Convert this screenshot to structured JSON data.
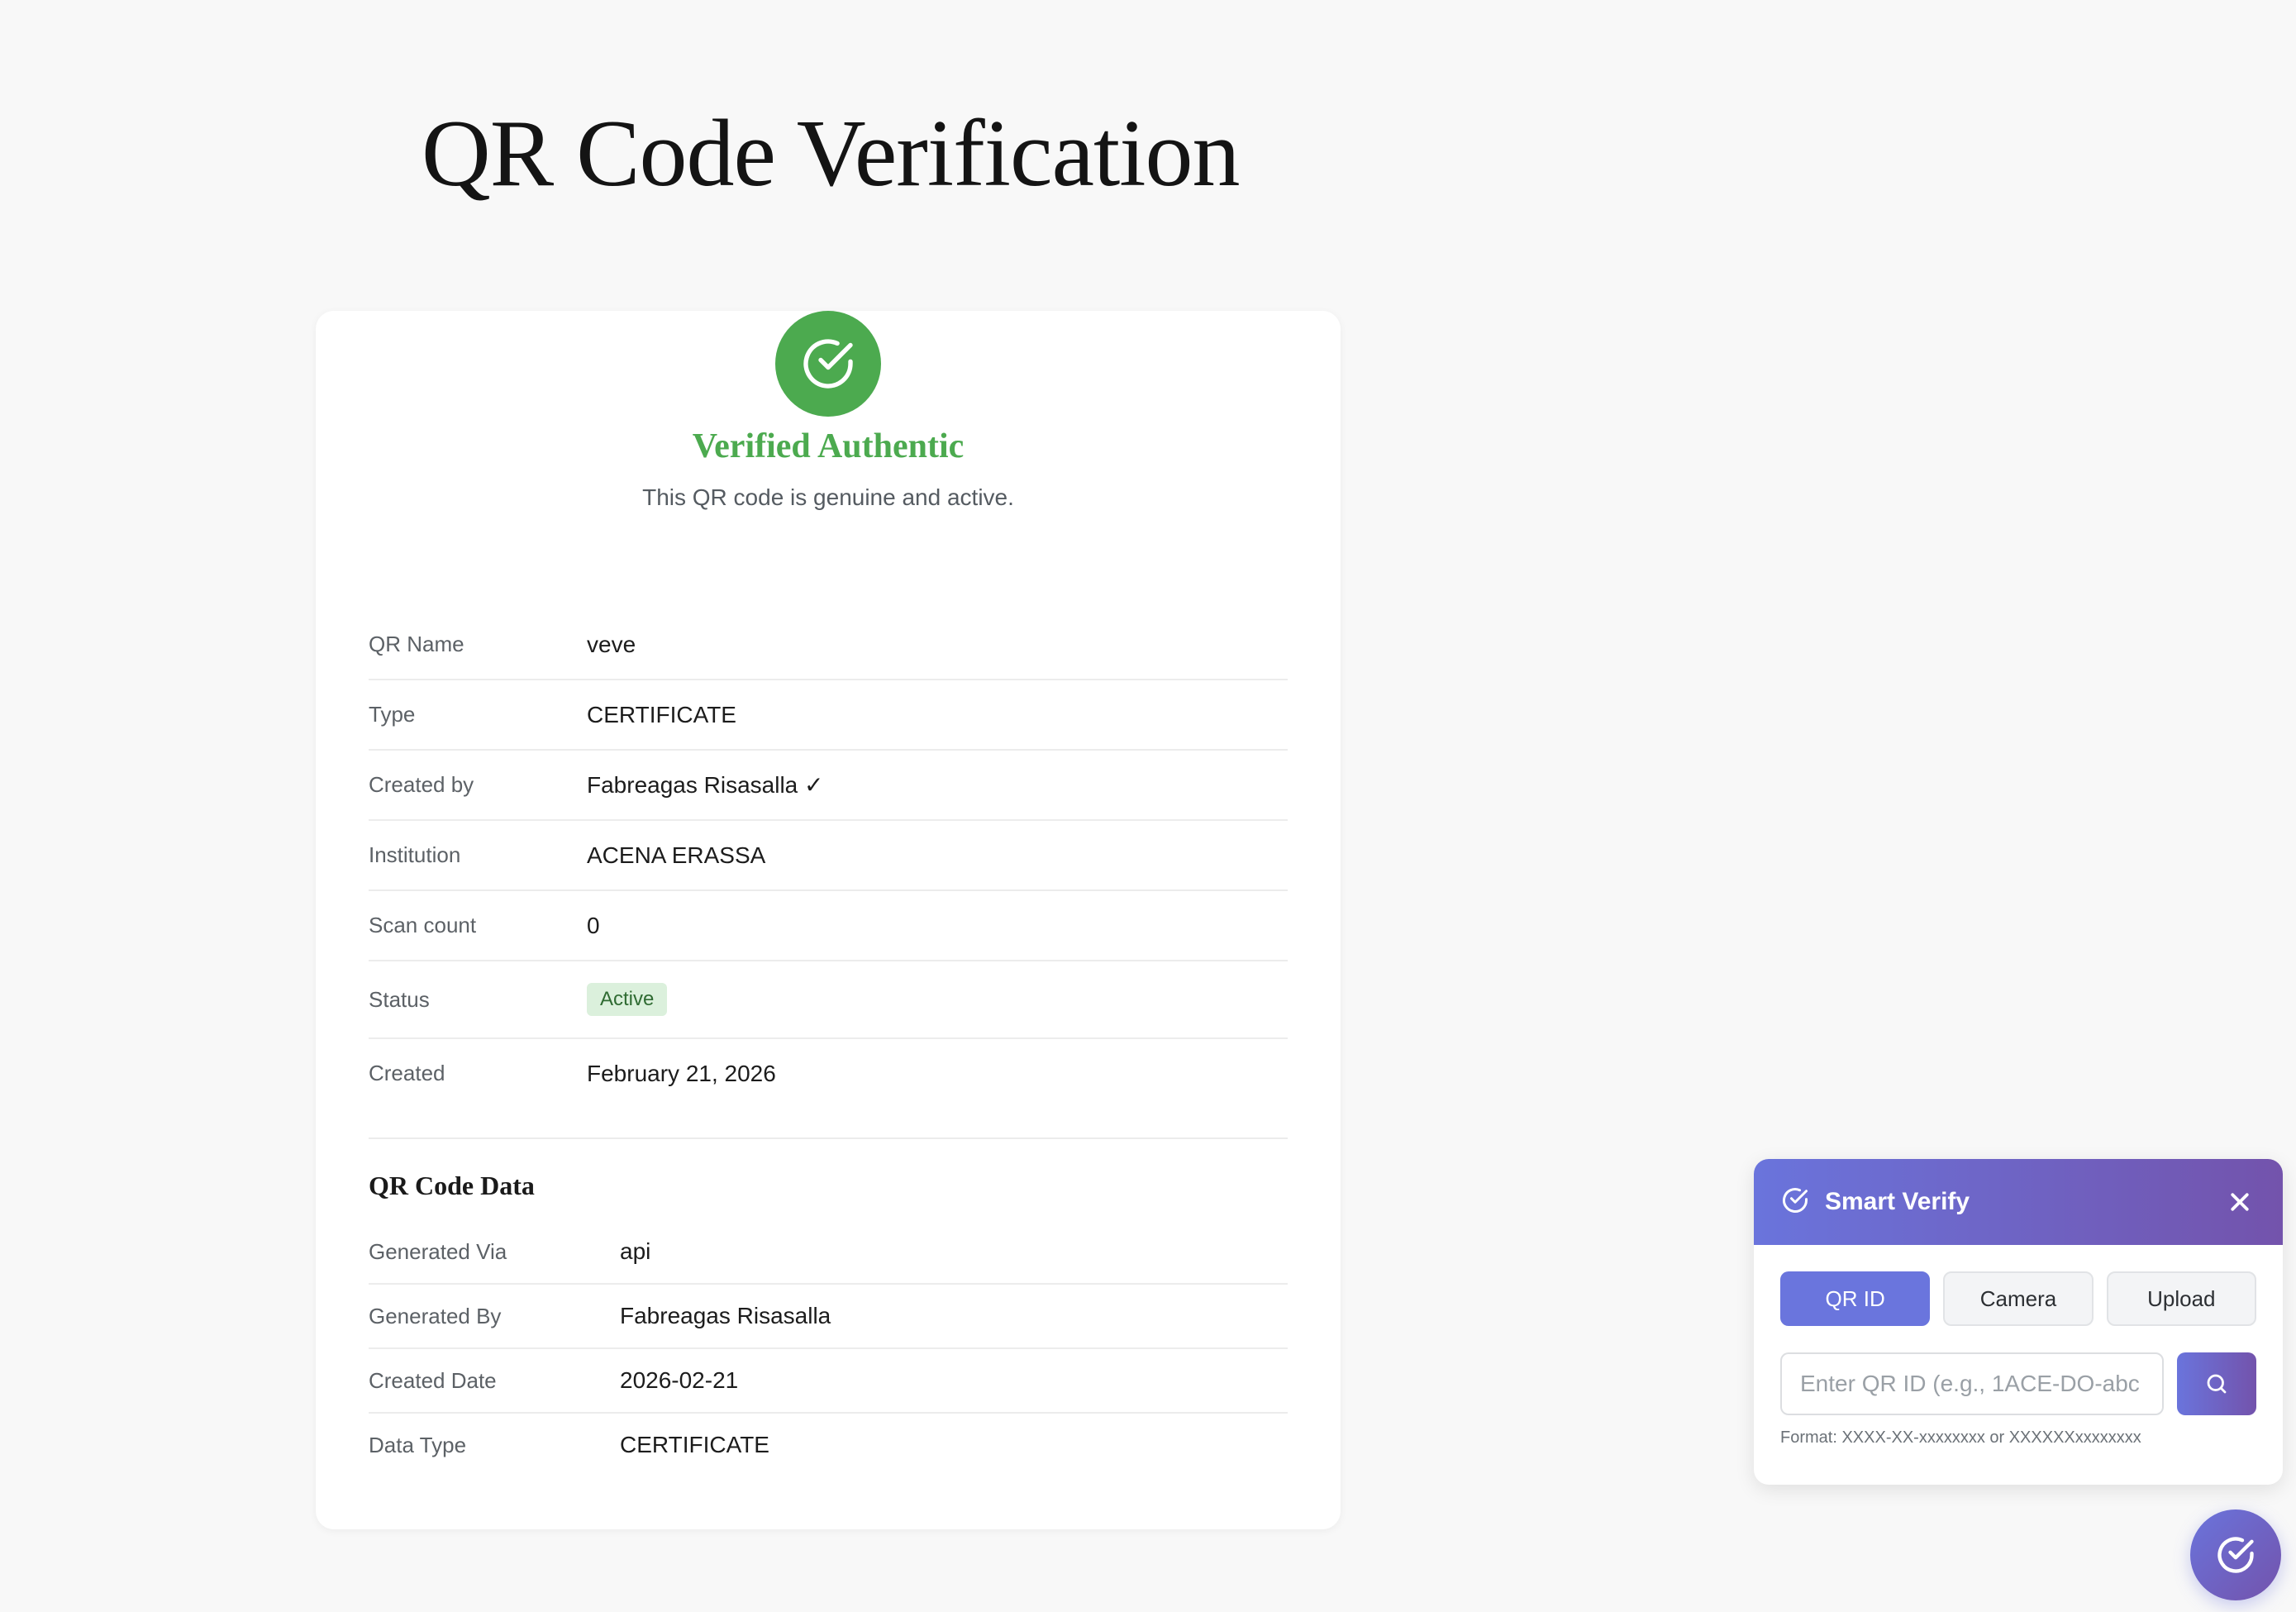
{
  "page": {
    "title": "QR Code Verification"
  },
  "verification": {
    "icon": "check-circle-icon",
    "title": "Verified Authentic",
    "subtitle": "This QR code is genuine and active.",
    "color": "#4caa4f"
  },
  "details": [
    {
      "label": "QR Name",
      "value": "veve"
    },
    {
      "label": "Type",
      "value": "CERTIFICATE"
    },
    {
      "label": "Created by",
      "value": "Fabreagas Risasalla ✓"
    },
    {
      "label": "Institution",
      "value": "ACENA ERASSA"
    },
    {
      "label": "Scan count",
      "value": "0"
    },
    {
      "label": "Status",
      "value": "Active"
    },
    {
      "label": "Created",
      "value": "February 21, 2026"
    }
  ],
  "qr_data": {
    "title": "QR Code Data",
    "rows": [
      {
        "label": "Generated Via",
        "value": "api"
      },
      {
        "label": "Generated By",
        "value": "Fabreagas Risasalla"
      },
      {
        "label": "Created Date",
        "value": "2026-02-21"
      },
      {
        "label": "Data Type",
        "value": "CERTIFICATE"
      }
    ]
  },
  "widget": {
    "title": "Smart Verify",
    "icons": {
      "header": "check-circle-icon",
      "close": "close-icon",
      "search": "search-icon",
      "fab": "check-circle-icon"
    },
    "tabs": [
      "QR ID",
      "Camera",
      "Upload"
    ],
    "active_tab": "QR ID",
    "input_placeholder": "Enter QR ID (e.g., 1ACE-DO-abc",
    "input_value": "",
    "format_hint": "Format: XXXX-XX-xxxxxxxx or XXXXXXxxxxxxxx",
    "accent_from": "#6a74dc",
    "accent_to": "#7353ac"
  }
}
